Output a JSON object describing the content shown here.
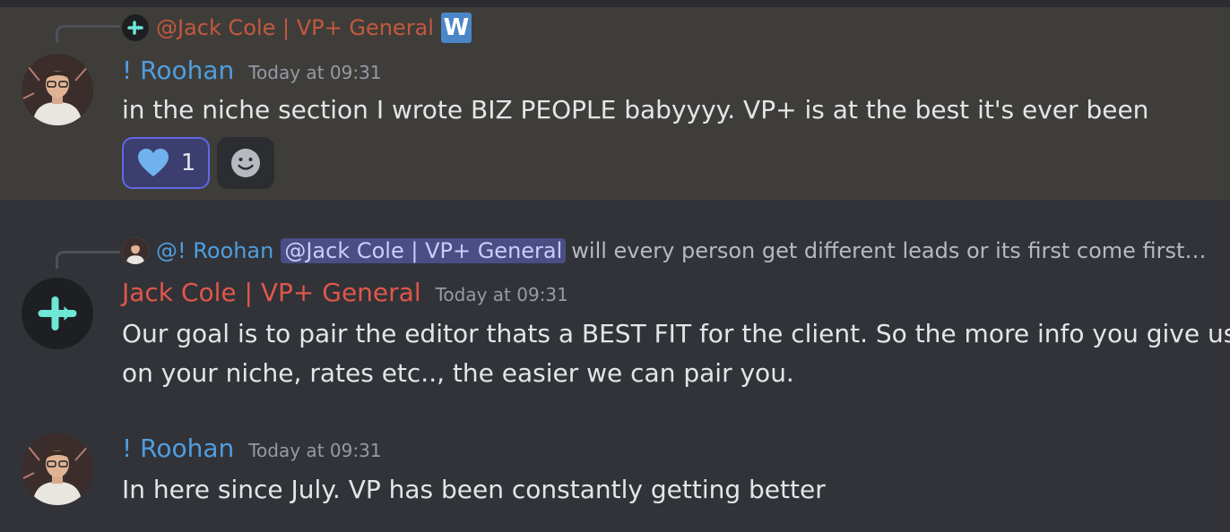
{
  "messages": [
    {
      "reply": {
        "author": "@Jack Cole | VP+ General",
        "badge": "W"
      },
      "author": "! Roohan",
      "timestamp": "Today at 09:31",
      "text": "in the niche section I wrote BIZ PEOPLE babyyyy. VP+ is at the best it's ever been",
      "reaction": {
        "icon": "heart-icon",
        "count": "1"
      }
    },
    {
      "reply": {
        "author": "@! Roohan",
        "mention": "@Jack Cole | VP+ General",
        "text": "will every person get different leads or its first come first s..."
      },
      "author": "Jack Cole | VP+ General",
      "timestamp": "Today at 09:31",
      "lines": [
        "Our goal is to pair the editor thats a BEST FIT for the client. So the more info you give us",
        "on your niche, rates etc.., the easier we can pair you."
      ]
    },
    {
      "author": "! Roohan",
      "timestamp": "Today at 09:31",
      "text": "In here since July. VP has been constantly getting better"
    }
  ],
  "colors": {
    "background": "#313338",
    "highlight": "#3f3d3a",
    "roohan_name": "#4f9ee0",
    "jack_name": "#e0574a",
    "mention_bg": "#4b4e85",
    "reaction_border": "#6168e3"
  }
}
